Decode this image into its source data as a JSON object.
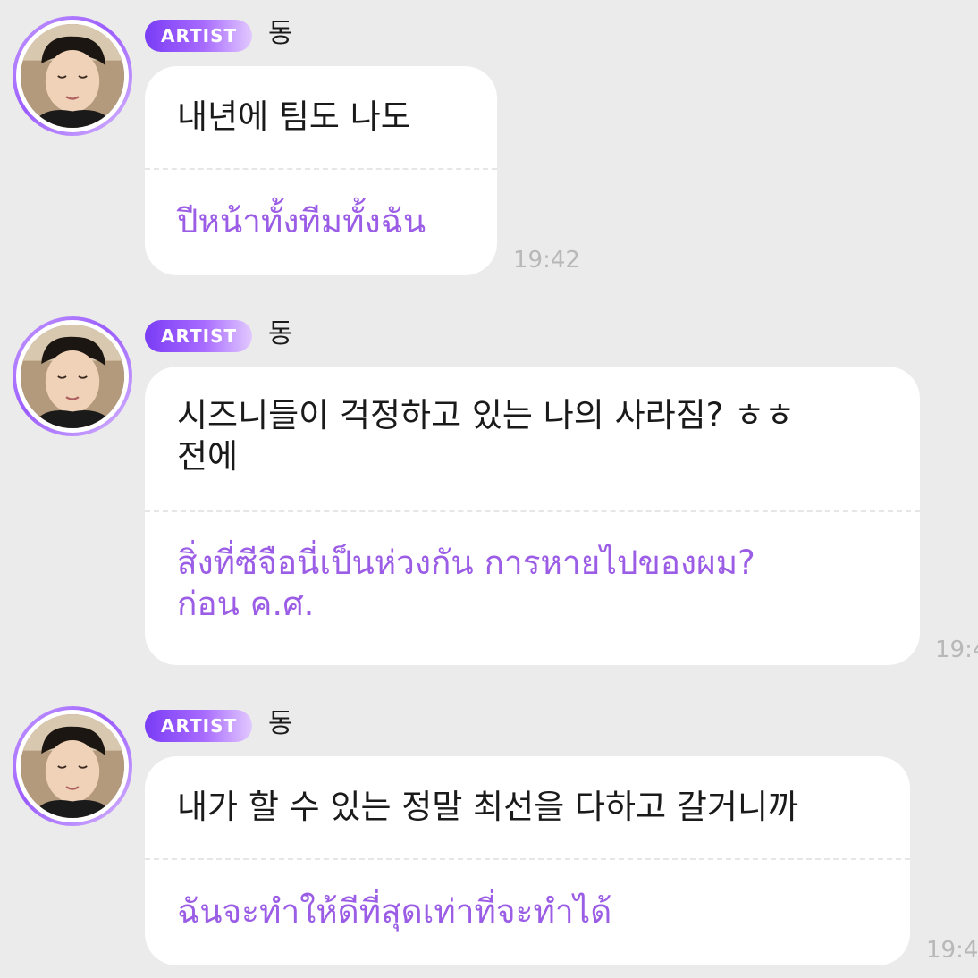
{
  "colors": {
    "background": "#ebebeb",
    "bubble": "#ffffff",
    "translation_text": "#9b5de5",
    "badge_gradient_start": "#7a3cf5",
    "badge_gradient_end": "#e2c9ff",
    "timestamp": "#b8b8b8"
  },
  "messages": [
    {
      "badge": "ARTIST",
      "author": "동",
      "original": "내년에 팀도 나도",
      "translation": "ปีหน้าทั้งทีมทั้งฉัน",
      "time": "19:42",
      "avatar_icon": "profile-photo"
    },
    {
      "badge": "ARTIST",
      "author": "동",
      "original": "시즈니들이 걱정하고 있는 나의 사라짐? ㅎㅎ\n전에",
      "translation": "สิ่งที่ซีจือนี่เป็นห่วงกัน การหายไปของผม?\nก่อน ค.ศ.",
      "time": "19:4",
      "avatar_icon": "profile-photo"
    },
    {
      "badge": "ARTIST",
      "author": "동",
      "original": "내가 할 수 있는 정말 최선을 다하고 갈거니까",
      "translation": "ฉันจะทำให้ดีที่สุดเท่าที่จะทำได้",
      "time": "19:4",
      "avatar_icon": "profile-photo"
    }
  ]
}
